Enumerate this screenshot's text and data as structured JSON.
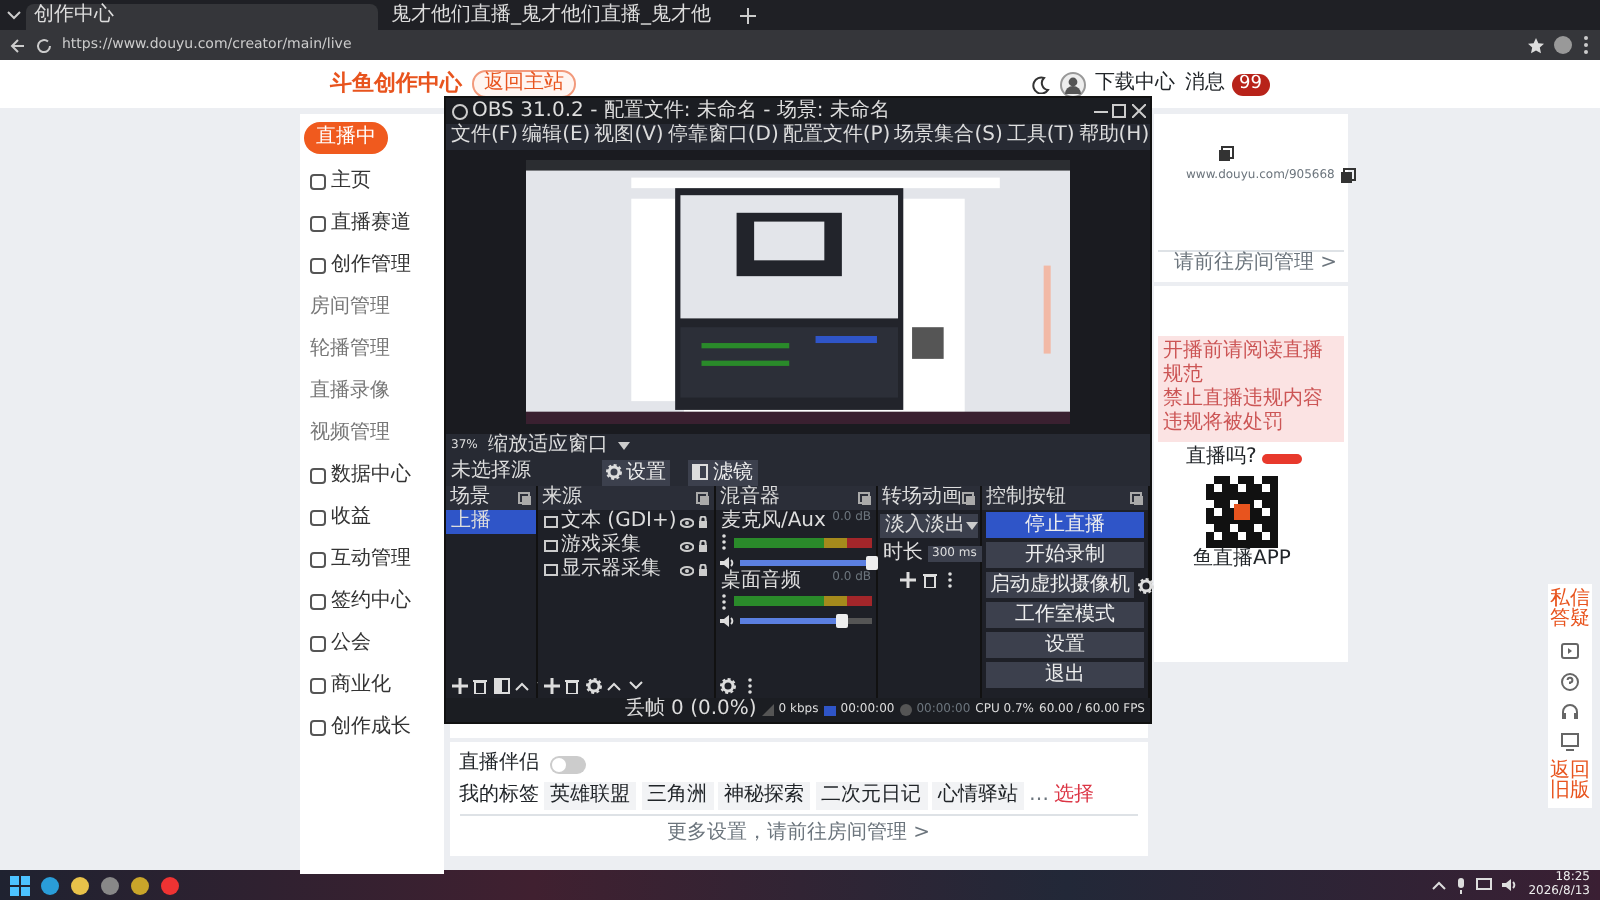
{
  "browser": {
    "tabs": [
      {
        "title": "创作中心",
        "selected": true
      },
      {
        "title": "鬼才他们直播_鬼才他们直播_鬼才他",
        "selected": false
      }
    ],
    "url": "https://www.douyu.com/creator/main/live"
  },
  "header": {
    "logo": "斗鱼创作中心",
    "back_button": "返回主站",
    "download": "下载中心",
    "messages": "消息",
    "message_badge": "99"
  },
  "sidebar": {
    "live_button": "直播中",
    "items": [
      {
        "label": "主页"
      },
      {
        "label": "直播赛道"
      },
      {
        "label": "创作管理",
        "children": [
          {
            "label": "房间管理"
          },
          {
            "label": "轮播管理"
          },
          {
            "label": "直播录像"
          },
          {
            "label": "视频管理"
          }
        ]
      },
      {
        "label": "数据中心"
      },
      {
        "label": "收益"
      },
      {
        "label": "互动管理"
      },
      {
        "label": "签约中心"
      },
      {
        "label": "公会"
      },
      {
        "label": "商业化"
      },
      {
        "label": "创作成长"
      }
    ]
  },
  "obs": {
    "title": "OBS 31.0.2 - 配置文件: 未命名 - 场景: 未命名",
    "menu": [
      "文件(F)",
      "编辑(E)",
      "视图(V)",
      "停靠窗口(D)",
      "配置文件(P)",
      "场景集合(S)",
      "工具(T)",
      "帮助(H)"
    ],
    "zoom": "37%",
    "zoom_mode": "缩放适应窗口",
    "no_source": "未选择源",
    "source_buttons": [
      "设置",
      "滤镜"
    ],
    "scenes": {
      "title": "场景",
      "items": [
        {
          "name": "上播",
          "selected": true
        }
      ]
    },
    "sources": {
      "title": "来源",
      "items": [
        {
          "name": "文本 (GDI+)"
        },
        {
          "name": "游戏采集"
        },
        {
          "name": "显示器采集"
        }
      ]
    },
    "mixer": {
      "title": "混音器",
      "channels": [
        {
          "name": "麦克风/Aux",
          "reading": "0.0 dB",
          "level": 1.0
        },
        {
          "name": "桌面音频",
          "reading": "0.0 dB",
          "level": 0.78
        }
      ]
    },
    "transitions": {
      "title": "转场动画",
      "type": "淡入淡出",
      "duration_label": "时长",
      "duration": "300 ms"
    },
    "controls": {
      "title": "控制按钮",
      "buttons": [
        {
          "label": "停止直播",
          "active": true
        },
        {
          "label": "开始录制",
          "active": false
        },
        {
          "label": "启动虚拟摄像机",
          "active": false
        },
        {
          "label": "工作室模式",
          "active": false
        },
        {
          "label": "设置",
          "active": false
        },
        {
          "label": "退出",
          "active": false
        }
      ]
    },
    "status": {
      "dropped": "丢帧 0 (0.0%)",
      "bitrate": "0 kbps",
      "live_time": "00:00:00",
      "rec_time": "00:00:00",
      "cpu": "CPU 0.7%",
      "fps": "60.00 / 60.00 FPS"
    }
  },
  "room": {
    "url": "www.douyu.com/905668",
    "manage_link": "请前往房间管理 >"
  },
  "notice": {
    "lines": [
      "开播前请阅读直播规范",
      "禁止直播违规内容",
      "违规将被处罚"
    ],
    "question": "直播吗?",
    "qr_caption": "鱼直播APP"
  },
  "settings": {
    "toggle": {
      "label": "直播伴侣",
      "on": false
    },
    "tags_label": "我的标签",
    "tags": [
      "英雄联盟",
      "三角洲",
      "神秘探索",
      "二次元日记",
      "心情驿站"
    ],
    "more": "…",
    "choose": "选择",
    "footer": "更多设置，请前往房间管理 >"
  },
  "float_bar": {
    "top": "私信答疑",
    "bottom": "返回旧版"
  },
  "taskbar": {
    "time": "18:25",
    "date": "2026/8/13"
  }
}
